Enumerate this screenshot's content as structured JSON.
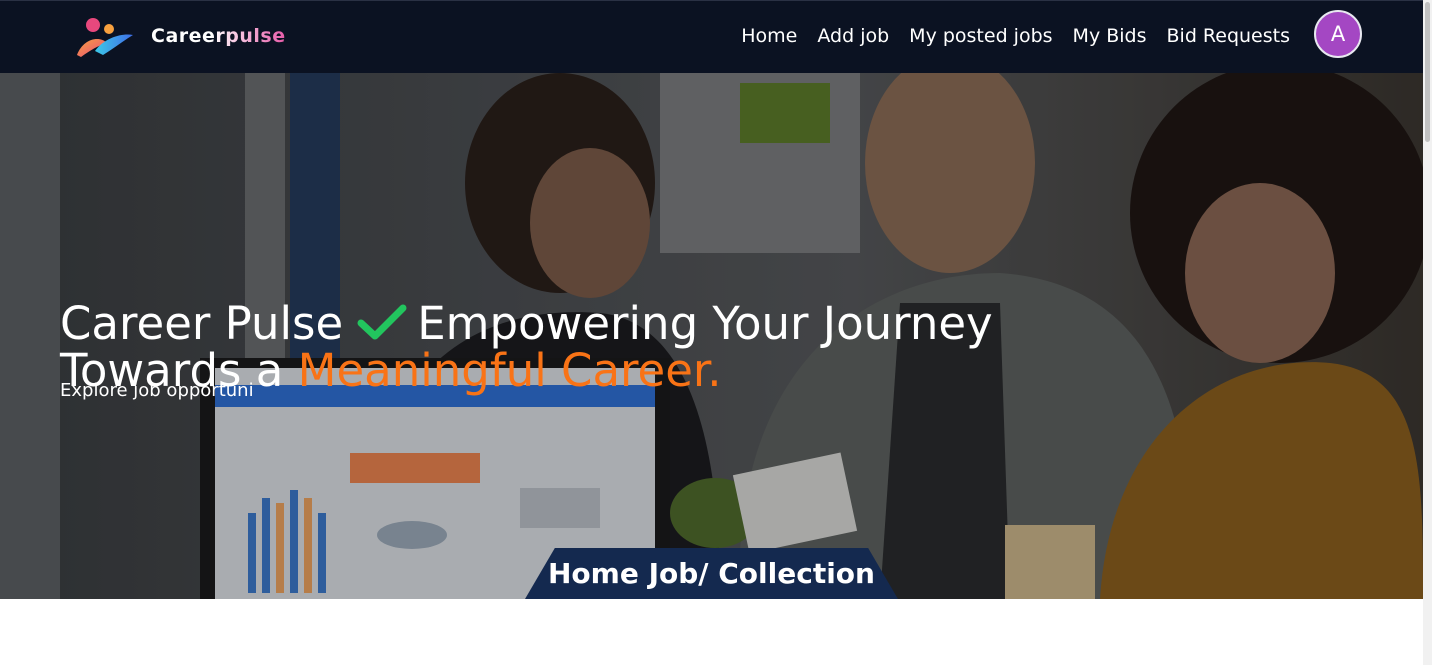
{
  "brand": {
    "name": "Careerpulse"
  },
  "nav": {
    "links": [
      "Home",
      "Add job",
      "My posted jobs",
      "My Bids",
      "Bid Requests"
    ],
    "avatar_initial": "A"
  },
  "hero": {
    "title_part1": "Career Pulse",
    "title_part2": "Empowering Your Journey Towards a",
    "title_accent": "Meaningful Career.",
    "subtitle": "Explore job opportuni",
    "section_title": "Home Job/ Collection"
  },
  "colors": {
    "navbar_bg": "#0b1222",
    "accent": "#f97316",
    "check": "#22c55e",
    "avatar": "#a447c3",
    "banner": "#14294f"
  },
  "icons": {
    "logo": "people-logo-icon",
    "check": "checkmark-icon"
  }
}
